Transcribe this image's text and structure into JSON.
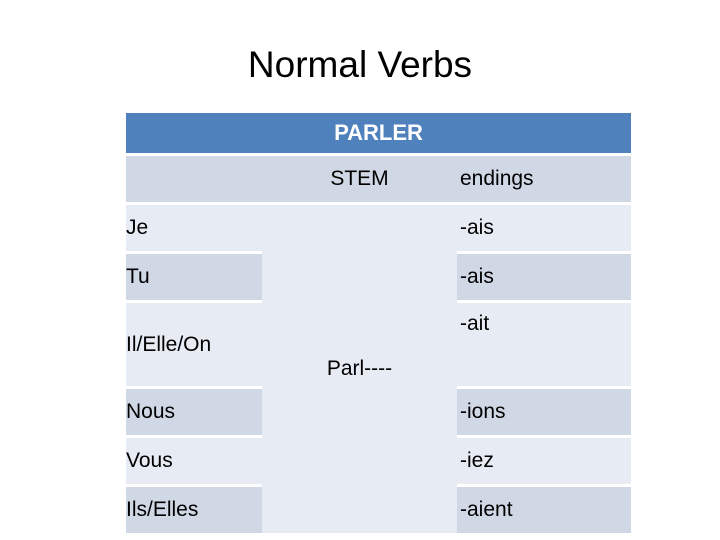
{
  "slide": {
    "title": "Normal Verbs",
    "background_color": "#ffffff"
  },
  "table": {
    "header_title": "PARLER",
    "header_color": "#4F81BD",
    "header_text_color": "#FFFFFF",
    "row_color_dark": "#D0D7E5",
    "row_color_light": "#E7EBF3",
    "column_headers": {
      "pronoun": "",
      "stem": "STEM",
      "endings": "endings"
    },
    "stem_value": "Parl----",
    "rows": [
      {
        "pronoun": "Je",
        "ending": "-ais"
      },
      {
        "pronoun": "Tu",
        "ending": "-ais"
      },
      {
        "pronoun": "Il/Elle/On",
        "ending": "-ait"
      },
      {
        "pronoun": "Nous",
        "ending": "-ions"
      },
      {
        "pronoun": "Vous",
        "ending": "-iez"
      },
      {
        "pronoun": "Ils/Elles",
        "ending": "-aient"
      }
    ]
  }
}
